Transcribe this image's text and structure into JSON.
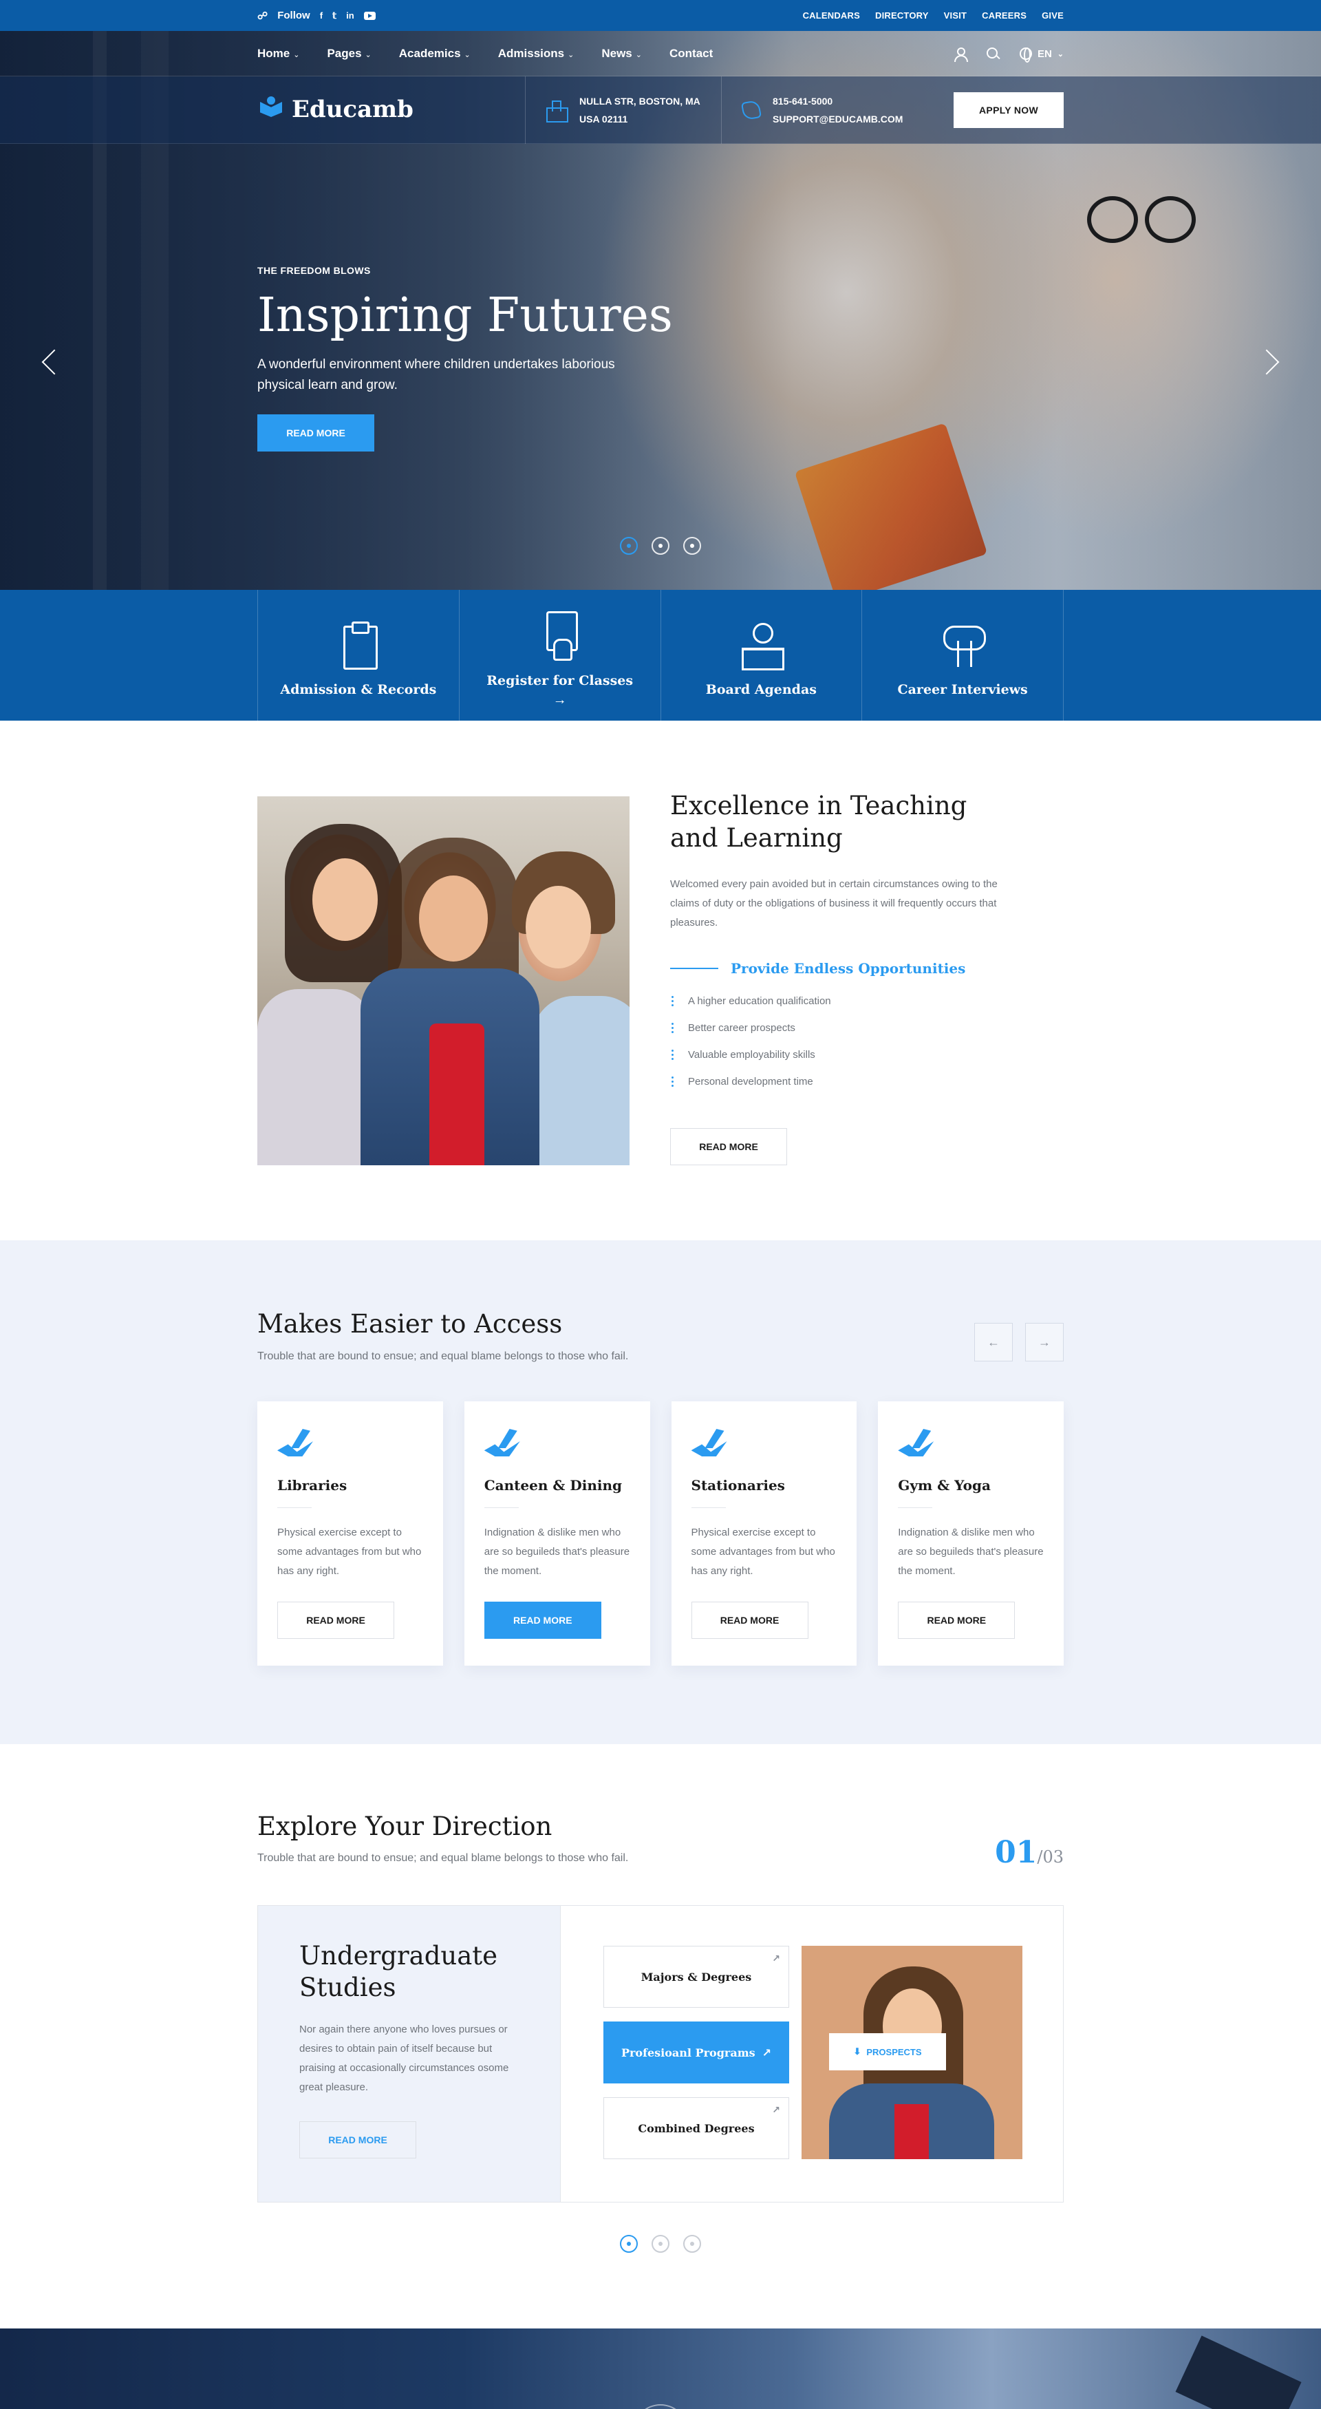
{
  "colors": {
    "primary": "#0b5ca6",
    "accent": "#2b9bf0",
    "light_bg": "#eef2fa",
    "text_muted": "#6e737a"
  },
  "topbar": {
    "follow_label": "Follow",
    "social_icons": [
      "facebook-icon",
      "twitter-icon",
      "linkedin-icon",
      "youtube-icon"
    ],
    "links": [
      "CALENDARS",
      "DIRECTORY",
      "VISIT",
      "CAREERS",
      "GIVE"
    ]
  },
  "nav": {
    "items": [
      {
        "label": "Home",
        "dropdown": true
      },
      {
        "label": "Pages",
        "dropdown": true
      },
      {
        "label": "Academics",
        "dropdown": true
      },
      {
        "label": "Admissions",
        "dropdown": true
      },
      {
        "label": "News",
        "dropdown": true
      },
      {
        "label": "Contact",
        "dropdown": false
      }
    ],
    "language": "EN"
  },
  "brand": {
    "name": "Educamb",
    "address_line1": "NULLA STR, BOSTON, MA",
    "address_line2": "USA 02111",
    "phone": "815-641-5000",
    "email": "SUPPORT@EDUCAMB.COM",
    "apply_label": "APPLY NOW"
  },
  "hero": {
    "eyebrow": "THE FREEDOM BLOWS",
    "title": "Inspiring Futures",
    "text": "A wonderful environment where children undertakes laborious physical learn and grow.",
    "button": "READ MORE",
    "active_slide": 1,
    "slide_count": 3
  },
  "features": [
    {
      "label": "Admission & Records",
      "icon": "clipboard-icon"
    },
    {
      "label": "Register for Classes",
      "icon": "tablet-touch-icon",
      "arrow": "→"
    },
    {
      "label": "Board Agendas",
      "icon": "teacher-desk-icon"
    },
    {
      "label": "Career Interviews",
      "icon": "cloud-ladder-icon"
    }
  ],
  "about": {
    "title_line1": "Excellence in Teaching",
    "title_line2": "and Learning",
    "text": "Welcomed every pain avoided but in certain circumstances owing to the claims of duty or the obligations of business it will frequently occurs that pleasures.",
    "subheading": "Provide Endless Opportunities",
    "list": [
      "A higher education qualification",
      "Better career prospects",
      "Valuable employability skills",
      "Personal development time"
    ],
    "button": "READ MORE"
  },
  "access": {
    "title": "Makes Easier to Access",
    "subtitle": "Trouble that are bound to ensue; and equal blame belongs to those who fail.",
    "prev_icon": "arrow-left-icon",
    "next_icon": "arrow-right-icon",
    "cards": [
      {
        "title": "Libraries",
        "text": "Physical exercise except to some advantages from but who has any right.",
        "button": "READ MORE",
        "highlight": false
      },
      {
        "title": "Canteen & Dining",
        "text": "Indignation & dislike men who are so beguileds that's pleasure the moment.",
        "button": "READ MORE",
        "highlight": true
      },
      {
        "title": "Stationaries",
        "text": "Physical exercise except to some advantages from but who has any right.",
        "button": "READ MORE",
        "highlight": false
      },
      {
        "title": "Gym & Yoga",
        "text": "Indignation & dislike men who are so beguileds that's pleasure the moment.",
        "button": "READ MORE",
        "highlight": false
      }
    ]
  },
  "direction": {
    "title": "Explore Your Direction",
    "subtitle": "Trouble that are bound to ensue; and equal blame belongs to those who fail.",
    "counter_current": "01",
    "counter_total": "/03",
    "panel_title_line1": "Undergraduate",
    "panel_title_line2": "Studies",
    "panel_text": "Nor again there anyone who loves pursues or desires to obtain pain of itself because but praising at occasionally circumstances osome great pleasure.",
    "panel_button": "READ MORE",
    "options": [
      {
        "label": "Majors & Degrees",
        "active": false
      },
      {
        "label": "Profesioanl Programs",
        "active": true
      },
      {
        "label": "Combined Degrees",
        "active": false
      }
    ],
    "prospects_label": "PROSPECTS",
    "active_dot": 1,
    "dot_count": 3
  }
}
